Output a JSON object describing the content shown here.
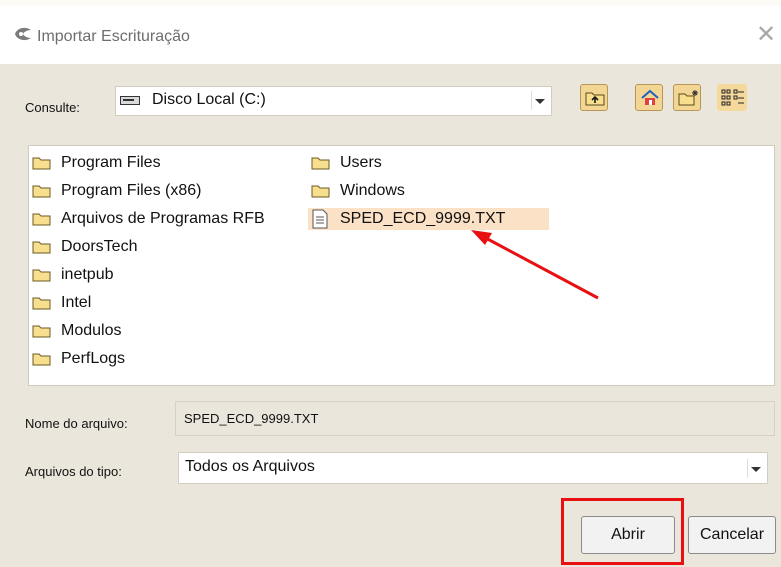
{
  "dialog": {
    "title": "Importar Escrituração",
    "close_glyph": "✕"
  },
  "look_in": {
    "label": "Consulte:",
    "value": "Disco Local (C:)",
    "icon": "drive-icon"
  },
  "toolbar": {
    "buttons": [
      "up-folder-icon",
      "home-icon",
      "new-folder-icon"
    ],
    "view_toggle": "list-details-icon"
  },
  "files": [
    {
      "name": "Program Files",
      "type": "folder"
    },
    {
      "name": "Program Files (x86)",
      "type": "folder"
    },
    {
      "name": "Arquivos de Programas RFB",
      "type": "folder"
    },
    {
      "name": "DoorsTech",
      "type": "folder"
    },
    {
      "name": "inetpub",
      "type": "folder"
    },
    {
      "name": "Intel",
      "type": "folder"
    },
    {
      "name": "Modulos",
      "type": "folder"
    },
    {
      "name": "PerfLogs",
      "type": "folder"
    },
    {
      "name": "Users",
      "type": "folder"
    },
    {
      "name": "Windows",
      "type": "folder"
    },
    {
      "name": "SPED_ECD_9999.TXT",
      "type": "file",
      "selected": true
    }
  ],
  "filename": {
    "label": "Nome do arquivo:",
    "value": "SPED_ECD_9999.TXT"
  },
  "filetype": {
    "label": "Arquivos do tipo:",
    "value": "Todos os Arquivos"
  },
  "buttons": {
    "open": "Abrir",
    "cancel": "Cancelar"
  },
  "colors": {
    "annotation": "#e81010",
    "selection": "#fbe1c6",
    "toolbar_button": "#f4d694"
  }
}
